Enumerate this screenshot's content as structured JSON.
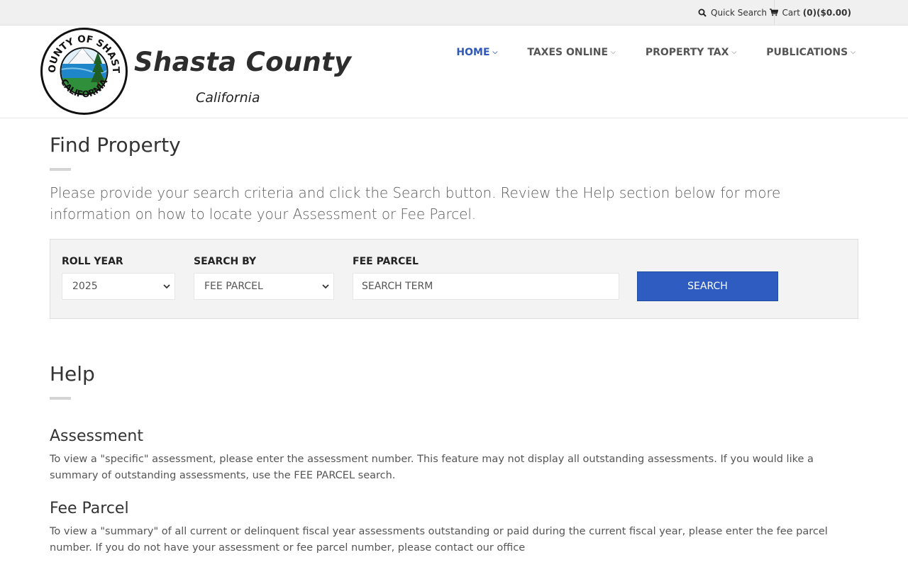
{
  "topbar": {
    "quick_search": "Quick Search",
    "cart_label": "Cart",
    "cart_count": "(0)",
    "cart_total": "($0.00)"
  },
  "header": {
    "seal_text": "COUNTY OF SHASTA CALIFORNIA",
    "title": "Shasta County",
    "subtitle": "California"
  },
  "nav": {
    "items": [
      {
        "label": "HOME",
        "active": true
      },
      {
        "label": "TAXES ONLINE",
        "active": false
      },
      {
        "label": "PROPERTY TAX",
        "active": false
      },
      {
        "label": "PUBLICATIONS",
        "active": false
      }
    ]
  },
  "find": {
    "title": "Find Property",
    "lead": "Please provide your search criteria and click the Search button. Review the Help section below for more information on how to locate your Assessment or Fee Parcel."
  },
  "search": {
    "roll_year_label": "ROLL YEAR",
    "roll_year_value": "2025",
    "search_by_label": "SEARCH BY",
    "search_by_value": "FEE PARCEL",
    "term_label": "FEE PARCEL",
    "term_placeholder": "SEARCH TERM",
    "button": "SEARCH"
  },
  "help": {
    "title": "Help",
    "sections": [
      {
        "heading": "Assessment",
        "text": "To view a \"specific\" assessment, please enter the assessment number. This feature may not display all outstanding assessments. If you would like a summary of outstanding assessments, use the FEE PARCEL search."
      },
      {
        "heading": "Fee Parcel",
        "text": "To view a \"summary\" of all current or delinquent fiscal year assessments outstanding or paid during the current fiscal year, please enter the fee parcel number. If you do not have your assessment or fee parcel number, please contact our office"
      }
    ]
  },
  "colors": {
    "accent": "#2f58b8",
    "button": "#2f5cc0"
  }
}
